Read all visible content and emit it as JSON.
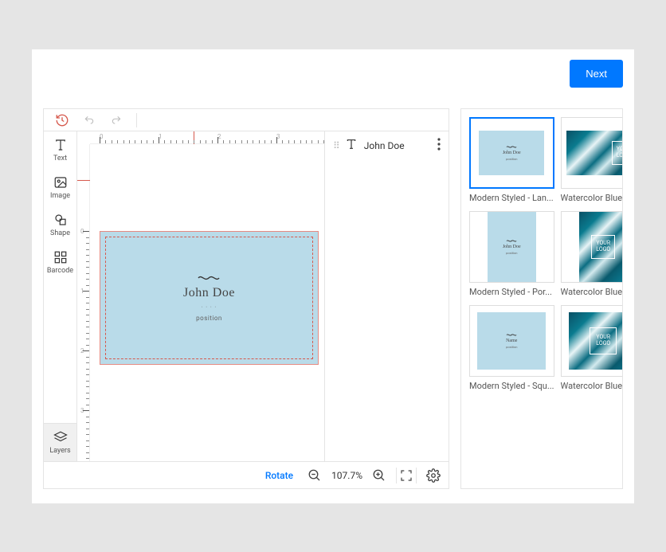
{
  "topbar": {
    "next": "Next"
  },
  "tools": {
    "text": "Text",
    "image": "Image",
    "shape": "Shape",
    "barcode": "Barcode",
    "layers": "Layers"
  },
  "card": {
    "name": "John Doe",
    "position": "position"
  },
  "props": {
    "selected_text": "John Doe"
  },
  "bottom": {
    "rotate": "Rotate",
    "zoom": "107.7%"
  },
  "rulers": {
    "h": [
      "0",
      "1",
      "2",
      "3"
    ],
    "h_pos": [
      12,
      86,
      160,
      234
    ],
    "v": [
      "0",
      "1",
      "2",
      "3"
    ],
    "v_pos": [
      125,
      200,
      275,
      350
    ]
  },
  "templates": [
    {
      "label": "Modern Styled - Lan...",
      "kind": "ms-land",
      "selected": true,
      "name": "John Doe",
      "pos": "position"
    },
    {
      "label": "Watercolor Blue - La...",
      "kind": "wc-land",
      "selected": false
    },
    {
      "label": "Modern Styled - Por...",
      "kind": "ms-port",
      "selected": false,
      "name": "John Doe",
      "pos": "position"
    },
    {
      "label": "Watercolor Blue - P...",
      "kind": "wc-port",
      "selected": false
    },
    {
      "label": "Modern Styled - Squ...",
      "kind": "ms-sq",
      "selected": false,
      "name": "Name",
      "pos": "position"
    },
    {
      "label": "Watercolor Blue - Sq...",
      "kind": "wc-sq",
      "selected": false
    }
  ]
}
